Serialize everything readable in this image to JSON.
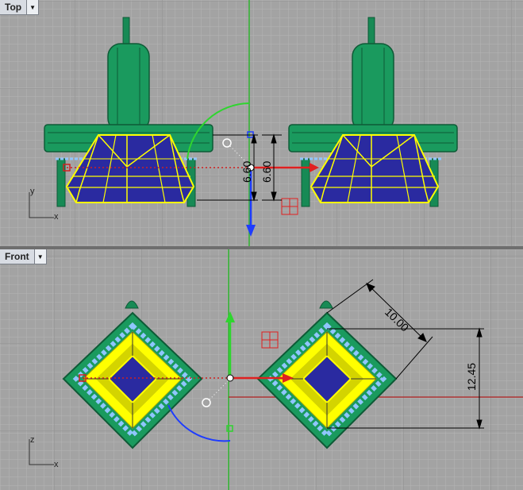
{
  "viewports": {
    "top": {
      "label": "Top",
      "axis_x": "x",
      "axis_y": "y",
      "dimension_1": "6.60",
      "dimension_2": "6.60"
    },
    "front": {
      "label": "Front",
      "axis_x": "x",
      "axis_y": "z",
      "dimension_width": "10.00",
      "dimension_height": "12.45"
    }
  },
  "icons": {
    "menu": "triangle-down-icon"
  },
  "colors": {
    "viewport_bg": "#a3a3a3",
    "grid_minor": "#b3b3b3",
    "grid_major": "#8e8e8e",
    "green_model": "#178a55",
    "yellow_wire": "#ffff00",
    "blue_stone": "#2a2aa0",
    "light_blue": "#8fc6ff",
    "axis_red": "#c81e1e",
    "axis_green": "#2fb52f",
    "axis_blue": "#1e3cff"
  }
}
